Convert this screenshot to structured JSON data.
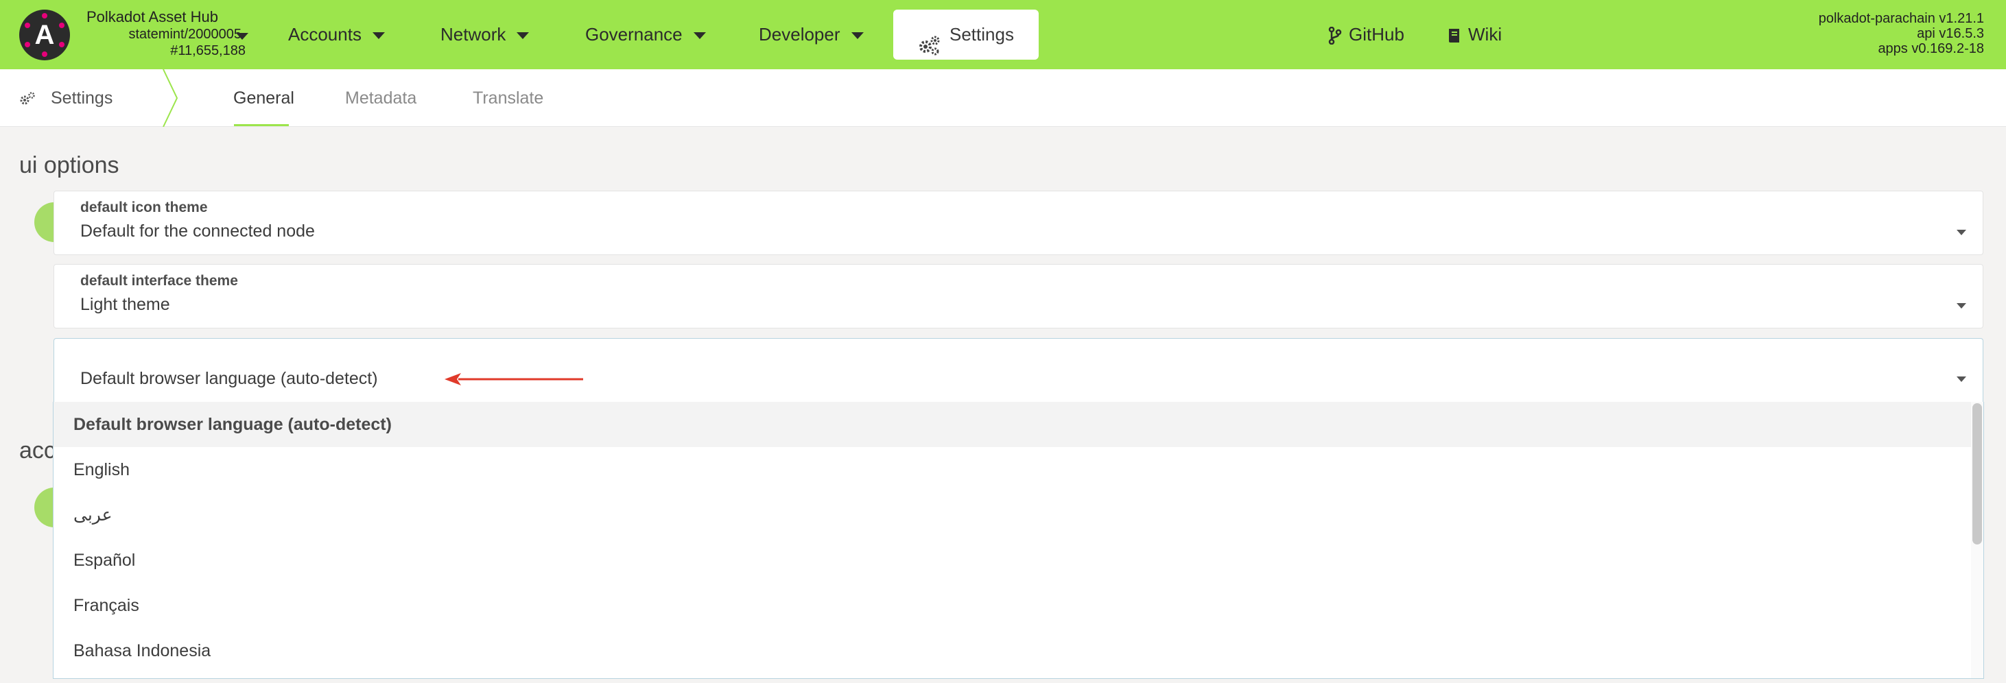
{
  "header": {
    "logo_letter": "A",
    "chain_name": "Polkadot Asset Hub",
    "chain_id": "statemint/2000005",
    "chain_block": "#11,655,188",
    "nav": [
      {
        "label": "Accounts"
      },
      {
        "label": "Network"
      },
      {
        "label": "Governance"
      },
      {
        "label": "Developer"
      }
    ],
    "settings_label": "Settings",
    "github_label": "GitHub",
    "wiki_label": "Wiki",
    "versions": {
      "node": "polkadot-parachain v1.21.1",
      "api": "api v16.5.3",
      "apps": "apps v0.169.2-18"
    }
  },
  "subnav": {
    "section_label": "Settings",
    "tabs": [
      {
        "label": "General",
        "active": true
      },
      {
        "label": "Metadata",
        "active": false
      },
      {
        "label": "Translate",
        "active": false
      }
    ]
  },
  "content": {
    "section_title": "ui options",
    "section_title_2_partial": "acc",
    "icon_theme": {
      "label": "default icon theme",
      "value": "Default for the connected node"
    },
    "interface_theme": {
      "label": "default interface theme",
      "value": "Light theme"
    },
    "language": {
      "value": "Default browser language (auto-detect)"
    },
    "language_options": [
      "Default browser language (auto-detect)",
      "English",
      "عربى",
      "Español",
      "Français",
      "Bahasa Indonesia"
    ]
  },
  "colors": {
    "accent_green": "#9ce54c",
    "annotation_arrow": "#e03a2a"
  }
}
